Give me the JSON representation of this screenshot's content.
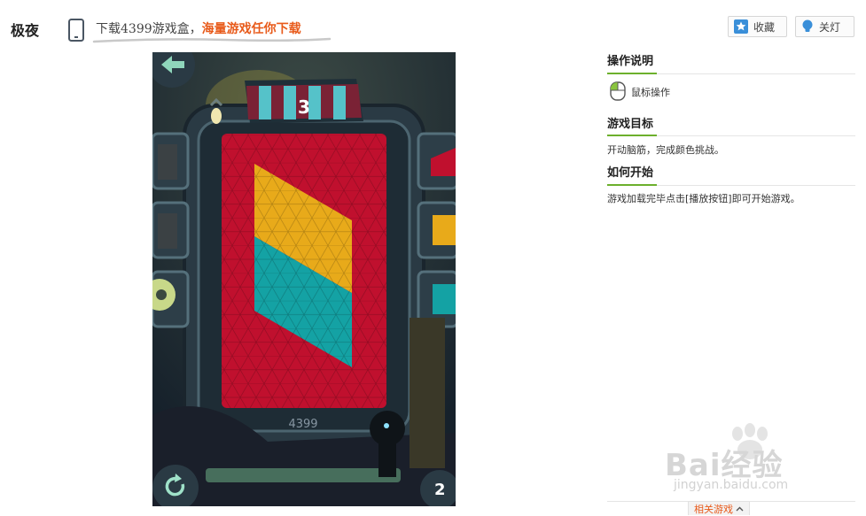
{
  "header": {
    "title": "极夜",
    "promo_part1": "下载4399游戏盒，",
    "promo_part2": "海量游戏任你下载",
    "buttons": {
      "favorite": "收藏",
      "lights_off": "关灯"
    }
  },
  "game": {
    "level": "3",
    "brand": "4399",
    "moves": "2",
    "colors": {
      "red": "#c0102e",
      "yellow": "#e8aa1a",
      "teal": "#14a2a4",
      "frame": "#2b3c46"
    }
  },
  "info": {
    "controls_title": "操作说明",
    "controls_text": "鼠标操作",
    "goal_title": "游戏目标",
    "goal_text": "开动脑筋，完成颜色挑战。",
    "start_title": "如何开始",
    "start_text": "游戏加载完毕点击[播放按钮]即可开始游戏。"
  },
  "watermark": {
    "brand": "Bai经验",
    "url": "jingyan.baidu.com"
  },
  "related": {
    "label": "相关游戏"
  }
}
